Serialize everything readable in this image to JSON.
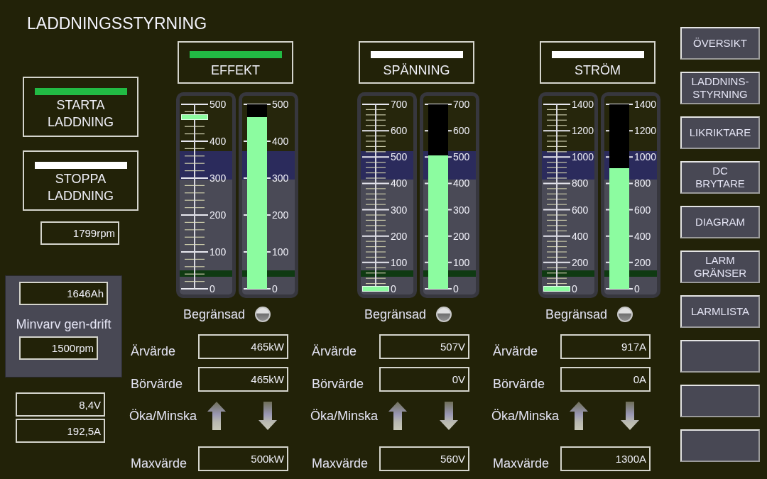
{
  "title": "LADDNINGSSTYRNING",
  "control_buttons": [
    {
      "label": "STARTA\nLADDNING",
      "active": true
    },
    {
      "label": "STOPPA\nLADDNING",
      "active": false
    }
  ],
  "speed_reading": "1799rpm",
  "gen_panel": {
    "reading": "1646Ah",
    "label": "Minvarv gen-drift",
    "value": "1500rpm"
  },
  "readings": [
    "8,4V",
    "192,5A"
  ],
  "groups": [
    {
      "title": "EFFEKT",
      "active": true,
      "setpoint_scale": {
        "ticks": [
          "500",
          "400",
          "300",
          "200",
          "100",
          "0"
        ],
        "level": 0.93
      },
      "bar": {
        "ticks": [
          "500",
          "400",
          "300",
          "200",
          "100",
          "0"
        ],
        "level": 0.93
      },
      "limit": {
        "label": "Begränsad",
        "on": false
      },
      "actual": {
        "label": "Ärvärde",
        "value": "465kW"
      },
      "setpoint": {
        "label": "Börvärde",
        "value": "465kW"
      },
      "adjust": {
        "label": "Öka/Minska"
      },
      "max": {
        "label": "Maxvärde",
        "value": "500kW"
      }
    },
    {
      "title": "SPÄNNING",
      "active": false,
      "setpoint_scale": {
        "ticks": [
          "700",
          "600",
          "500",
          "400",
          "300",
          "200",
          "100",
          "0"
        ],
        "level": 0
      },
      "bar": {
        "ticks": [
          "700",
          "600",
          "500",
          "400",
          "300",
          "200",
          "100",
          "0"
        ],
        "level": 0.724
      },
      "limit": {
        "label": "Begränsad",
        "on": false
      },
      "actual": {
        "label": "Ärvärde",
        "value": "507V"
      },
      "setpoint": {
        "label": "Börvärde",
        "value": "0V"
      },
      "adjust": {
        "label": "Öka/Minska"
      },
      "max": {
        "label": "Maxvärde",
        "value": "560V"
      }
    },
    {
      "title": "STRÖM",
      "active": false,
      "setpoint_scale": {
        "ticks": [
          "1400",
          "1200",
          "1000",
          "800",
          "600",
          "400",
          "200",
          "0"
        ],
        "level": 0
      },
      "bar": {
        "ticks": [
          "1400",
          "1200",
          "1000",
          "800",
          "600",
          "400",
          "200",
          "0"
        ],
        "level": 0.655
      },
      "limit": {
        "label": "Begränsad",
        "on": false
      },
      "actual": {
        "label": "Ärvärde",
        "value": "917A"
      },
      "setpoint": {
        "label": "Börvärde",
        "value": "0A"
      },
      "adjust": {
        "label": "Öka/Minska"
      },
      "max": {
        "label": "Maxvärde",
        "value": "1300A"
      }
    }
  ],
  "nav_buttons": [
    {
      "kind": "label",
      "label": "ÖVERSIKT"
    },
    {
      "kind": "label",
      "label": "LADDNINS-\nSTYRNING"
    },
    {
      "kind": "label",
      "label": "LIKRIKTARE"
    },
    {
      "kind": "label",
      "label": "DC\nBRYTARE"
    },
    {
      "kind": "label",
      "label": "DIAGRAM"
    },
    {
      "kind": "label",
      "label": "LARM\nGRÄNSER"
    },
    {
      "kind": "label",
      "label": "LARMLISTA"
    },
    {
      "kind": "blank"
    },
    {
      "kind": "blank"
    },
    {
      "kind": "blank"
    }
  ]
}
